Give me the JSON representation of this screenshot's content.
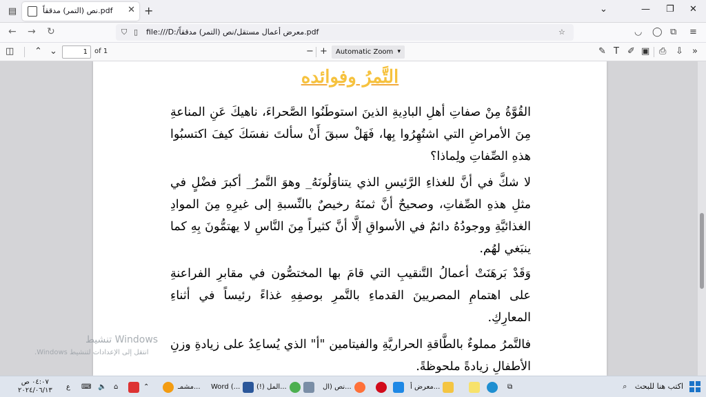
{
  "browser": {
    "tab_title": "نص (التمر) مدققاً.pdf",
    "url": "file:///D:/معرض أعمال مستقل/نص (التمر) مدققاً.pdf"
  },
  "pdf_toolbar": {
    "page_number": "1",
    "page_of": "of 1",
    "zoom": "Automatic Zoom"
  },
  "document": {
    "title": "التَّمرُ وفوائده",
    "paragraphs": [
      "القُوَّةُ مِنْ صفاتِ أهلِ البادِيةِ الذينَ استوطَنُوا الصَّحراءَ، ناهيكَ عَنِ المناعةِ مِنَ الأمراضِ التي اشتُهِرُوا بِها، فَهَلْ سبقَ أَنْ سألتَ نفسَكَ كيفَ اكتسبُوا هذهِ الصِّفاتِ ولِماذا؟",
      "لا شكَّ في أنَّ للغذاءِ الرَّئيسِ الذي يتناوَلُونَهُ_ وهوَ التَّمرُ_ أكبرَ فضْلٍ في مثلِ هذهِ الصِّفاتِ، وصحيحٌ أنَّ ثمنَهُ رخيصٌ بالنِّسبةِ إلى غيرِهِ مِنَ الموادِ الغذائيَّةِ ووجودُهُ دائمٌ في الأسواقِ إلَّا أنَّ كثيراً مِنَ النَّاسِ لا يهتمُّونَ بِهِ كما ينبَغي لهُم.",
      "وَقَدْ بَرهَنَتْ أعمالُ التَّنقيبِ التي قامَ بها المختصُّون في مقابرِ الفراعنةِ على اهتمامِ المصريينَ القدماءِ بالتَّمرِ بوصفِهِ غذاءً رئيساً في أثناءِ المعارِكِ.",
      "فالتَّمرُ مملوءٌ بالطَّاقةِ الحراريَّةِ والفيتامين \"أ\" الذي يُساعِدُ على زيادةِ وزنِ الأطفالِ زيادةً ملحوظةً."
    ]
  },
  "watermark": {
    "title": "تنشيط Windows",
    "subtitle": "انتقل إلى الإعدادات لتنشيط Windows."
  },
  "taskbar": {
    "search_placeholder": "اكتب هنا للبحث",
    "items": [
      "معرض أ...",
      "نص (ال...",
      "(!) المل...",
      "Word (...",
      "مشمـ..."
    ],
    "time": "٠٤:٠٧ ص",
    "date": "٢٠٢٤/٠٦/١٣",
    "lang": "ع"
  }
}
